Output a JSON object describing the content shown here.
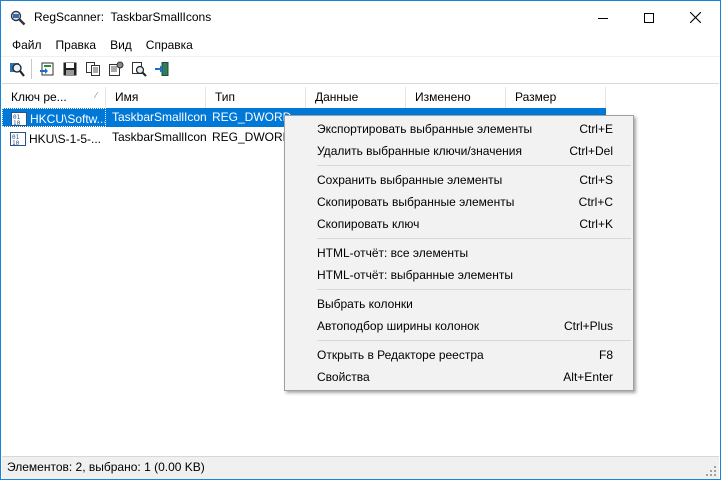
{
  "window": {
    "title": "RegScanner:  TaskbarSmallIcons"
  },
  "menu": {
    "items": [
      "Файл",
      "Правка",
      "Вид",
      "Справка"
    ]
  },
  "toolbar": {
    "buttons": [
      "find-icon",
      "export-icon",
      "save-icon",
      "copy-icon",
      "properties-icon",
      "regedit-icon",
      "exit-icon"
    ]
  },
  "list": {
    "columns": [
      "Ключ ре...",
      "Имя",
      "Тип",
      "Данные",
      "Изменено",
      "Размер"
    ],
    "rows": [
      {
        "key": "HKCU\\Softw...",
        "name": "TaskbarSmallIcons",
        "type": "REG_DWORD"
      },
      {
        "key": "HKU\\S-1-5-...",
        "name": "TaskbarSmallIcons",
        "type": "REG_DWORD"
      }
    ]
  },
  "context_menu": {
    "items": [
      {
        "label": "Экспортировать выбранные элементы",
        "shortcut": "Ctrl+E"
      },
      {
        "label": "Удалить выбранные ключи/значения",
        "shortcut": "Ctrl+Del"
      },
      {
        "label": "Сохранить выбранные элементы",
        "shortcut": "Ctrl+S"
      },
      {
        "label": "Скопировать выбранные элементы",
        "shortcut": "Ctrl+C"
      },
      {
        "label": "Скопировать ключ",
        "shortcut": "Ctrl+K"
      },
      {
        "label": "HTML-отчёт: все элементы",
        "shortcut": ""
      },
      {
        "label": "HTML-отчёт: выбранные элементы",
        "shortcut": ""
      },
      {
        "label": "Выбрать колонки",
        "shortcut": ""
      },
      {
        "label": "Автоподбор ширины колонок",
        "shortcut": "Ctrl+Plus"
      },
      {
        "label": "Открыть в Редакторе реестра",
        "shortcut": "F8"
      },
      {
        "label": "Свойства",
        "shortcut": "Alt+Enter"
      }
    ]
  },
  "status": {
    "text": "Элементов: 2, выбрано: 1  (0.00 KB)"
  },
  "colors": {
    "selection": "#0078d7",
    "border": "#1883d7",
    "menu_bg": "#f2f2f2"
  }
}
